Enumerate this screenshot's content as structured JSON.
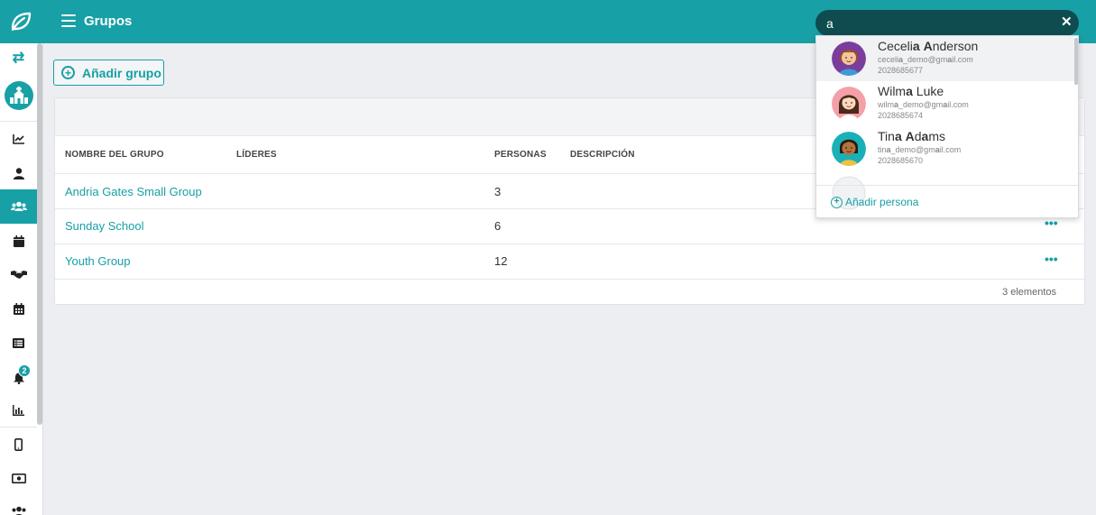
{
  "header": {
    "page_title": "Grupos",
    "search_value": "a"
  },
  "toolbar": {
    "add_group_label": "Añadir grupo"
  },
  "table": {
    "columns": [
      "NOMBRE DEL GRUPO",
      "LÍDERES",
      "PERSONAS",
      "DESCRIPCIÓN"
    ],
    "rows": [
      {
        "name": "Andria Gates Small Group",
        "people": "3"
      },
      {
        "name": "Sunday School",
        "people": "6"
      },
      {
        "name": "Youth Group",
        "people": "12"
      }
    ],
    "footer_count": "3 elementos"
  },
  "sidebar": {
    "notification_count": "2",
    "items": [
      "swap-icon",
      "church-icon",
      "chart-line-icon",
      "user-icon",
      "users-icon",
      "calendar-icon",
      "handshake-icon",
      "calendar-grid-icon",
      "list-icon",
      "bell-icon",
      "bar-chart-icon",
      "mobile-icon",
      "money-icon",
      "users-cog-icon"
    ]
  },
  "dropdown": {
    "people": [
      {
        "name_parts": [
          "Ceceli",
          "a",
          " ",
          "A",
          "nderson"
        ],
        "email_parts": [
          "ceceli",
          "a",
          "_demo@gm",
          "a",
          "il.com"
        ],
        "phone": "2028685677"
      },
      {
        "name_parts": [
          "Wilm",
          "a",
          " Luke"
        ],
        "email_parts": [
          "wilm",
          "a",
          "_demo@gm",
          "a",
          "il.com"
        ],
        "phone": "2028685674"
      },
      {
        "name_parts": [
          "Tin",
          "a",
          " ",
          "A",
          "d",
          "a",
          "ms"
        ],
        "email_parts": [
          "tin",
          "a",
          "_demo@gm",
          "a",
          "il.com"
        ],
        "phone": "2028685670"
      }
    ],
    "add_person_label": "Añadir persona"
  },
  "colors": {
    "accent": "#17a0a6",
    "search_bg": "#0f4c50",
    "background": "#eceef1"
  }
}
